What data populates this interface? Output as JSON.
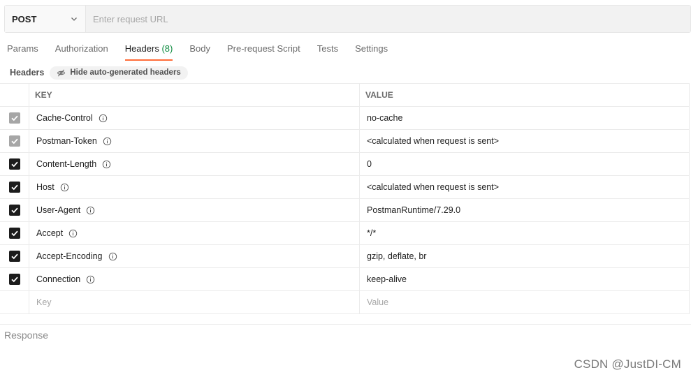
{
  "request": {
    "method": "POST",
    "url_placeholder": "Enter request URL",
    "url_value": ""
  },
  "tabs": [
    {
      "label": "Params",
      "count": ""
    },
    {
      "label": "Authorization",
      "count": ""
    },
    {
      "label": "Headers",
      "count": "(8)",
      "active": true
    },
    {
      "label": "Body",
      "count": ""
    },
    {
      "label": "Pre-request Script",
      "count": ""
    },
    {
      "label": "Tests",
      "count": ""
    },
    {
      "label": "Settings",
      "count": ""
    }
  ],
  "headers_section": {
    "title": "Headers",
    "hide_button": "Hide auto-generated headers"
  },
  "table": {
    "columns": {
      "key": "KEY",
      "value": "VALUE"
    },
    "rows": [
      {
        "key": "Cache-Control",
        "value": "no-cache",
        "checked": true,
        "auto": true
      },
      {
        "key": "Postman-Token",
        "value": "<calculated when request is sent>",
        "checked": true,
        "auto": true
      },
      {
        "key": "Content-Length",
        "value": "0",
        "checked": true,
        "auto": false
      },
      {
        "key": "Host",
        "value": "<calculated when request is sent>",
        "checked": true,
        "auto": false
      },
      {
        "key": "User-Agent",
        "value": "PostmanRuntime/7.29.0",
        "checked": true,
        "auto": false
      },
      {
        "key": "Accept",
        "value": "*/*",
        "checked": true,
        "auto": false
      },
      {
        "key": "Accept-Encoding",
        "value": "gzip, deflate, br",
        "checked": true,
        "auto": false
      },
      {
        "key": "Connection",
        "value": "keep-alive",
        "checked": true,
        "auto": false
      }
    ],
    "new_row": {
      "key_placeholder": "Key",
      "value_placeholder": "Value"
    }
  },
  "response": {
    "title": "Response"
  },
  "watermark": "CSDN @JustDI-CM",
  "colors": {
    "accent": "#ff6c37",
    "count_green": "#0b8a3e",
    "checkbox": "#1c1c1c",
    "checkbox_disabled": "#a6a6a6"
  },
  "icons": {
    "method_dropdown": "chevron-down-icon",
    "hide": "eye-slash-icon",
    "info": "info-icon",
    "check": "checkmark-icon"
  }
}
